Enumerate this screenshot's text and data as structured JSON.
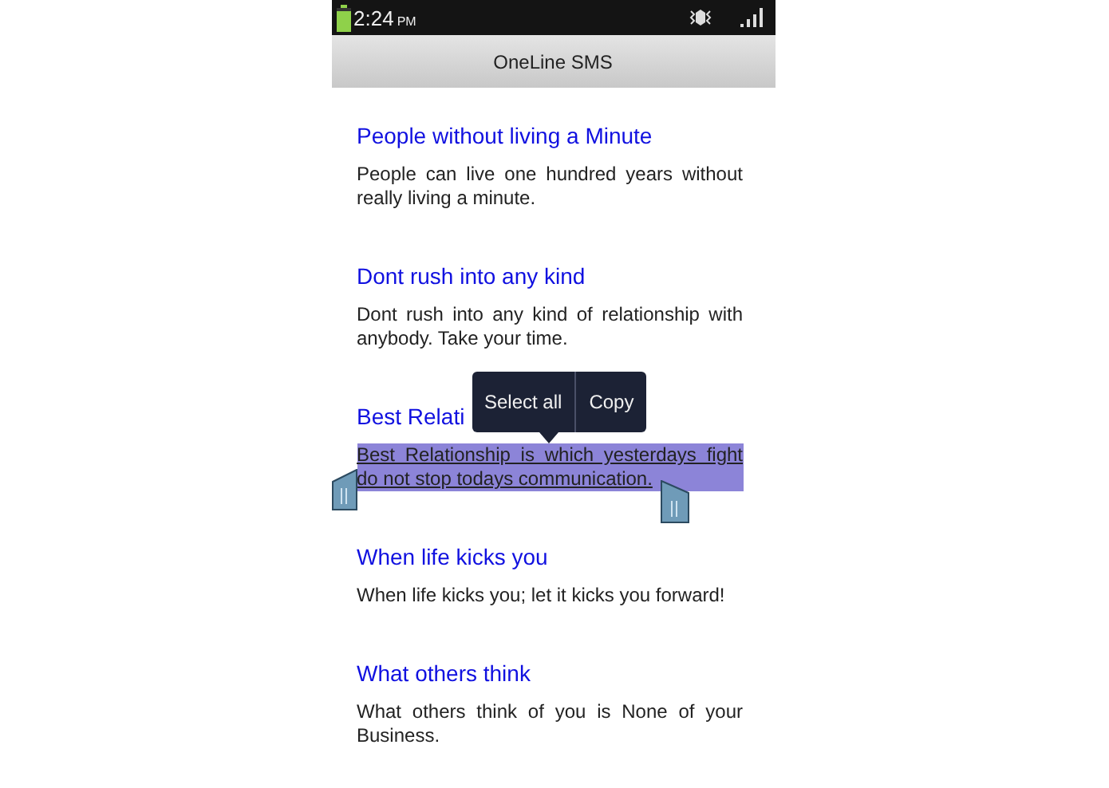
{
  "status_bar": {
    "time": "2:24",
    "ampm": "PM"
  },
  "app_bar": {
    "title": "OneLine SMS"
  },
  "messages": [
    {
      "title": "People without living a Minute",
      "body": "People can live one hundred years without really living a minute.",
      "selected": false
    },
    {
      "title": "Dont rush into any kind",
      "body": "Dont rush into any kind of relationship with anybody. Take your time.",
      "selected": false
    },
    {
      "title": "Best Relati",
      "body": "Best Relationship is which yesterdays fight do not stop todays communication.",
      "selected": true
    },
    {
      "title": "When life kicks you",
      "body": "When life kicks you; let it kicks you forward!",
      "selected": false
    },
    {
      "title": "What others think",
      "body": "What others think of you is None of your Business.",
      "selected": false
    }
  ],
  "context_menu": {
    "items": [
      "Select all",
      "Copy"
    ]
  }
}
